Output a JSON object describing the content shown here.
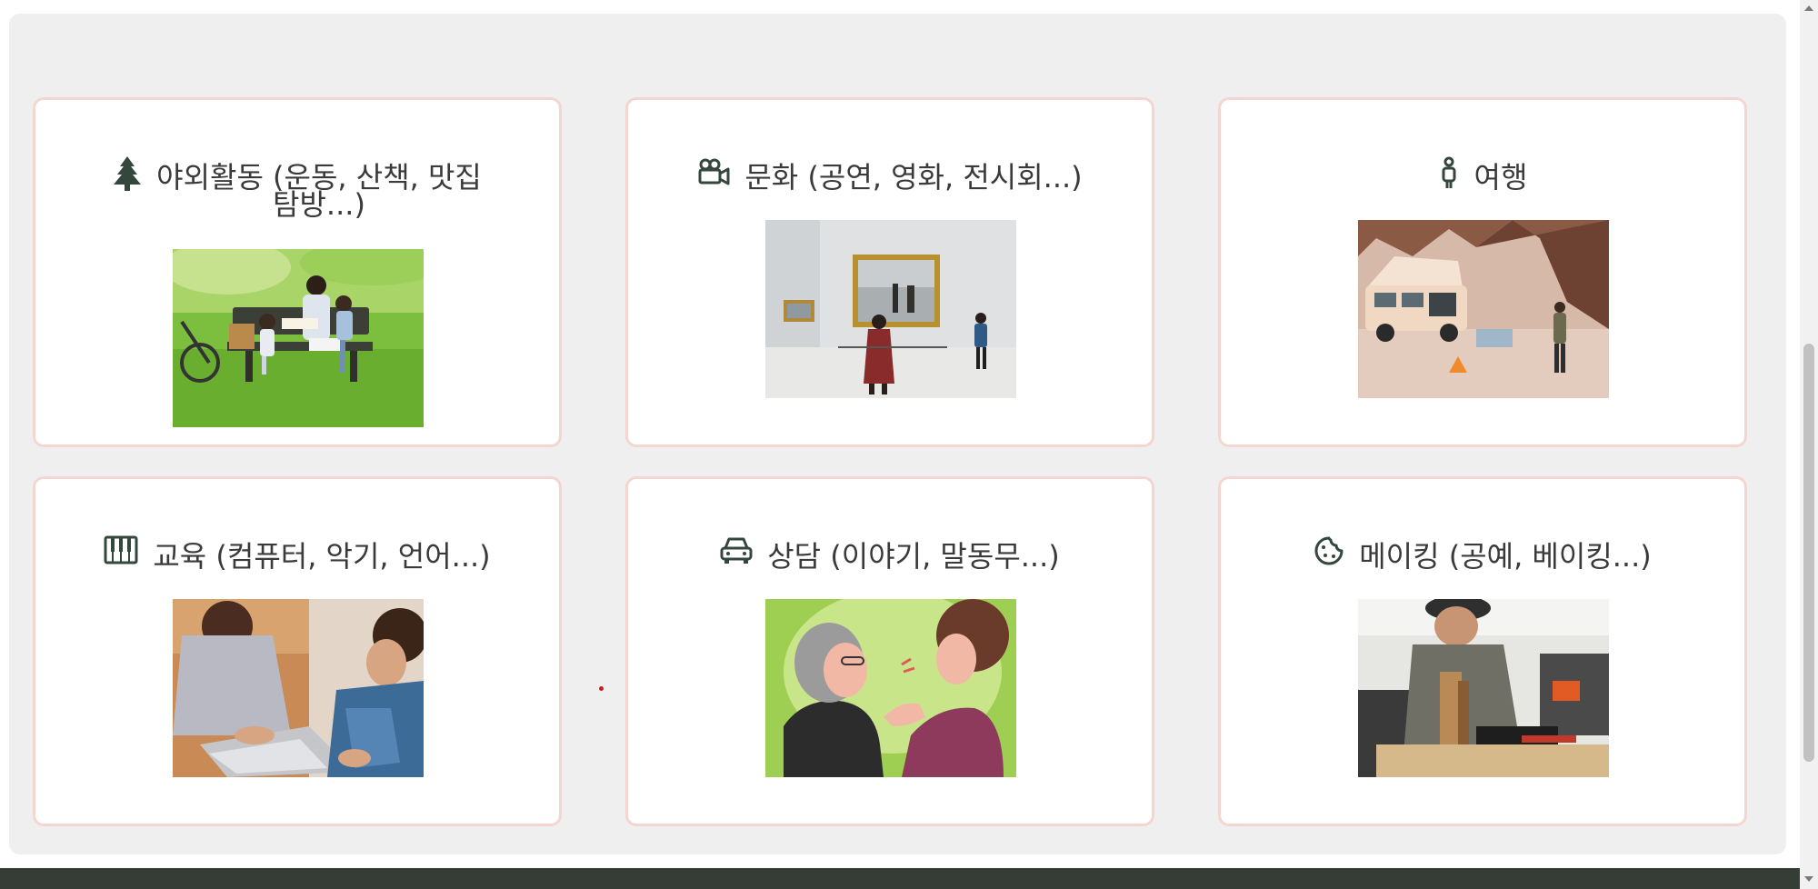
{
  "cards": [
    {
      "title_line1": "야외활동 (운동, 산책, 맛집",
      "title_line2": "탐방...)",
      "icon": "tree-icon",
      "photo": "family-on-park-bench-photo"
    },
    {
      "title": "문화 (공연, 영화, 전시회...)",
      "icon": "video-camera-icon",
      "photo": "art-gallery-visitors-photo"
    },
    {
      "title": "여행",
      "icon": "person-icon",
      "photo": "camper-van-campsite-photo"
    },
    {
      "title": "교육 (컴퓨터, 악기, 언어...)",
      "icon": "piano-keys-icon",
      "photo": "students-with-laptop-photo"
    },
    {
      "title": "상담 (이야기, 말동무...)",
      "icon": "car-icon",
      "photo": "two-women-talking-illustration"
    },
    {
      "title": "메이킹 (공예, 베이킹...)",
      "icon": "cookie-icon",
      "photo": "woodworking-workshop-photo"
    }
  ],
  "colors": {
    "panel_bg": "#efefef",
    "card_border": "#f3d6d0",
    "title_text": "#3a3a3a",
    "icon": "#34473c",
    "footer": "#363c36"
  }
}
